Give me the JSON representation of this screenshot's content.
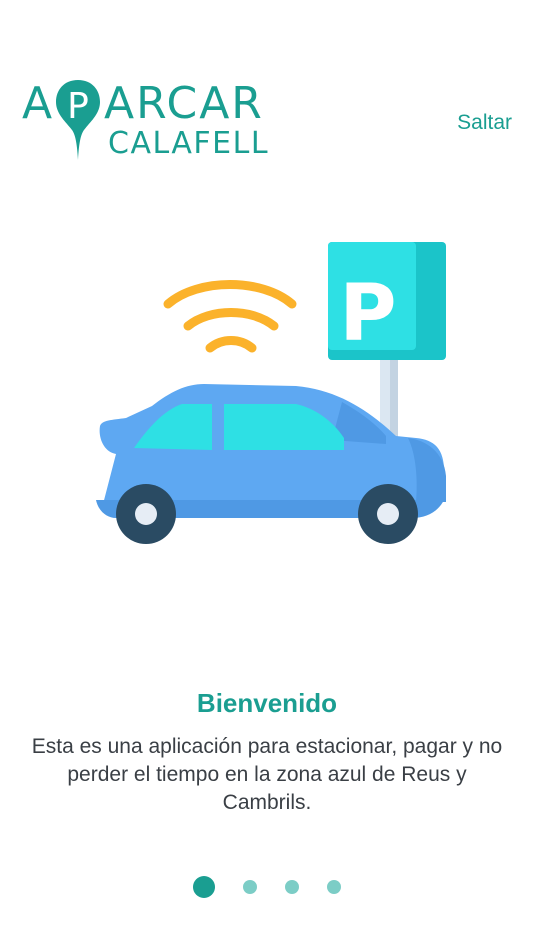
{
  "logo": {
    "line1_prefix": "A",
    "line1_suffix": "ARCAR",
    "pin_letter": "P",
    "line2": "CALAFELL"
  },
  "header": {
    "skip_label": "Saltar"
  },
  "onboarding": {
    "title": "Bienvenido",
    "description": "Esta es una aplicación para estacionar, pagar y no perder el tiempo en la zona azul de Reus y Cambrils.",
    "illustration_icon": "smart-parking-car-icon"
  },
  "pager": {
    "total_pages": 4,
    "current_page": 1
  },
  "colors": {
    "brand": "#1a9e91",
    "dot_inactive": "#7ccdc6",
    "text": "#3a3f45",
    "car_blue": "#5ea8f2",
    "sign_cyan": "#2ee0e4",
    "wifi_orange": "#fbb22b"
  }
}
